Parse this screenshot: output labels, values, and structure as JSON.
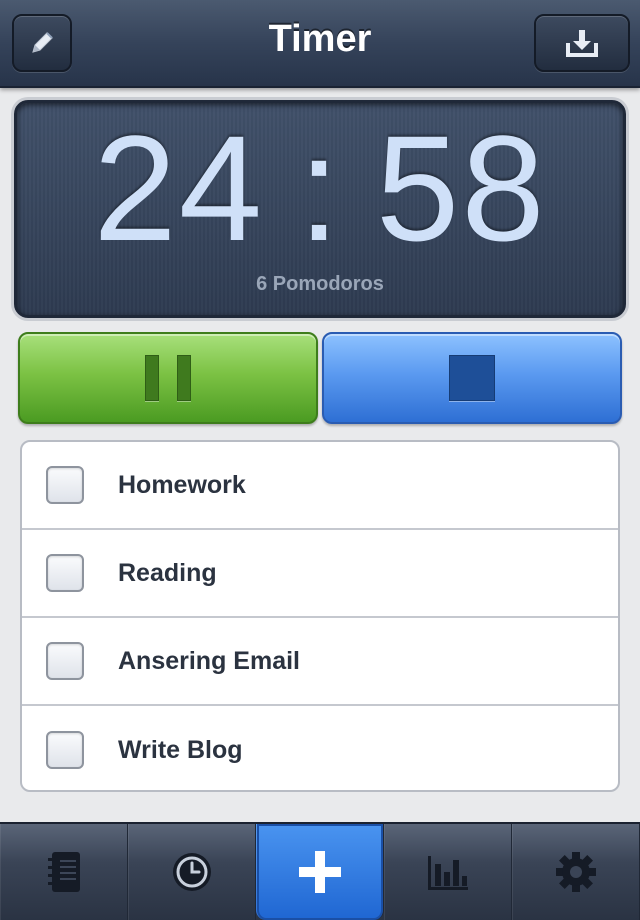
{
  "navbar": {
    "title": "Timer",
    "left_icon": "pencil-icon",
    "right_icon": "download-tray-icon"
  },
  "timer": {
    "minutes": "24",
    "separator": ":",
    "seconds": "58",
    "pomodoro_label": "6 Pomodoros"
  },
  "controls": {
    "pause_icon": "pause-icon",
    "stop_icon": "stop-icon",
    "pause_color": "#6cbc34",
    "stop_color": "#4a8ff0"
  },
  "tasks": [
    {
      "label": "Homework",
      "checked": false
    },
    {
      "label": "Reading",
      "checked": false
    },
    {
      "label": "Ansering Email",
      "checked": false
    },
    {
      "label": "Write Blog",
      "checked": false
    }
  ],
  "tabbar": {
    "tabs": [
      {
        "icon": "notebook-icon",
        "active": false
      },
      {
        "icon": "clock-icon",
        "active": false
      },
      {
        "icon": "plus-icon",
        "active": true
      },
      {
        "icon": "bar-chart-icon",
        "active": false
      },
      {
        "icon": "gear-icon",
        "active": false
      }
    ],
    "active_color": "#2a78e0"
  }
}
